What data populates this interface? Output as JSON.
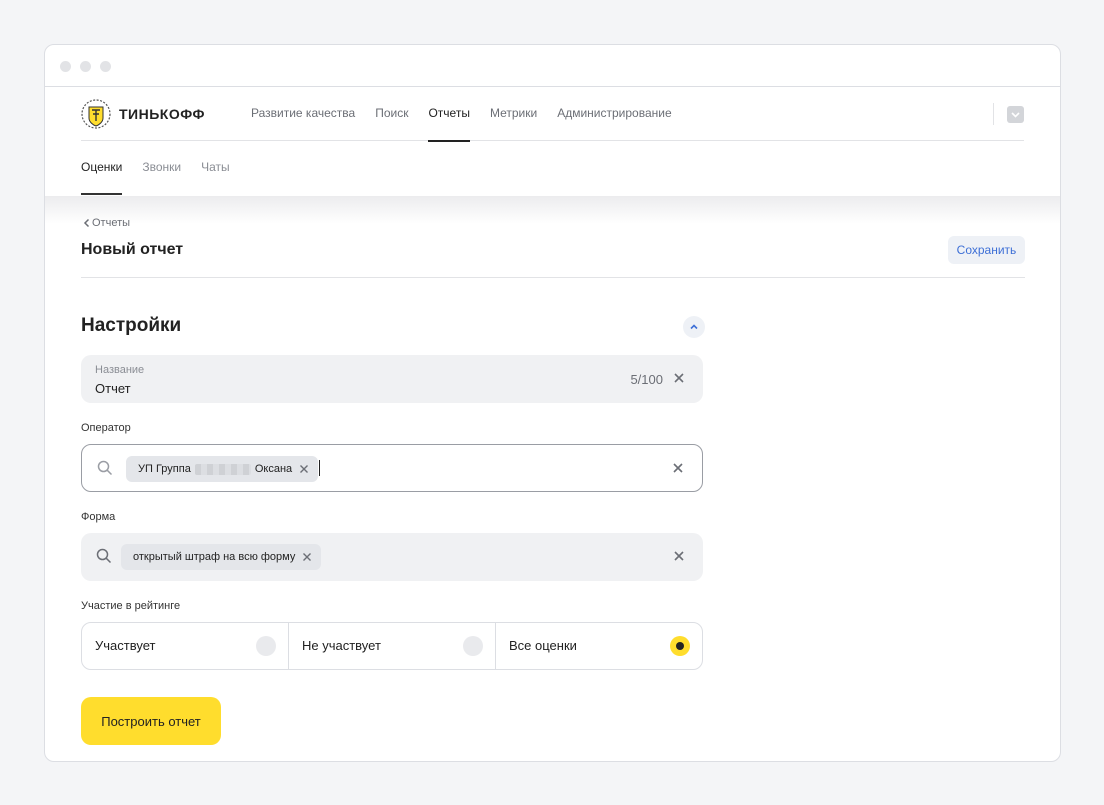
{
  "app": {
    "brand": "ТИНЬКОФФ"
  },
  "nav": {
    "items": [
      "Развитие качества",
      "Поиск",
      "Отчеты",
      "Метрики",
      "Администрирование"
    ],
    "active": "Отчеты"
  },
  "subnav": {
    "items": [
      "Оценки",
      "Звонки",
      "Чаты"
    ],
    "active": "Оценки"
  },
  "page": {
    "back_label": "Отчеты",
    "title": "Новый отчет",
    "save_label": "Сохранить"
  },
  "settings": {
    "title": "Настройки",
    "name_field": {
      "label": "Название",
      "value": "Отчет",
      "counter": "5/100"
    },
    "operator": {
      "label": "Оператор",
      "chip_prefix": "УП Группа",
      "chip_suffix": "Оксана"
    },
    "form": {
      "label": "Форма",
      "chip": "открытый штраф на всю форму"
    },
    "rating": {
      "label": "Участие в рейтинге",
      "options": [
        "Участвует",
        "Не участвует",
        "Все оценки"
      ],
      "selected": "Все оценки"
    },
    "build_label": "Построить отчет"
  },
  "colors": {
    "accent": "#ffdd2d",
    "link": "#3d6fd6"
  },
  "icons": [
    "search-icon",
    "close-icon",
    "chevron-left-icon",
    "chevron-up-icon",
    "logo-icon"
  ]
}
